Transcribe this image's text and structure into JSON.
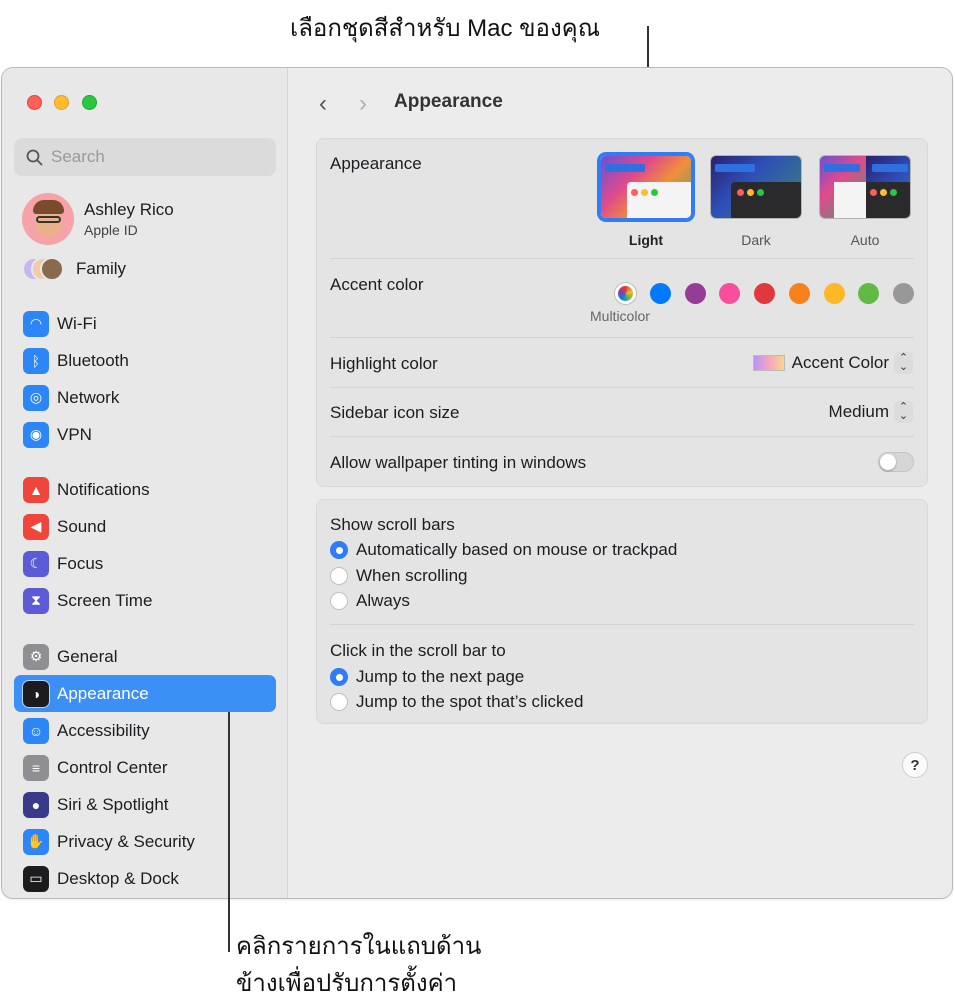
{
  "callouts": {
    "top": "เลือกชุดสีสำหรับ Mac ของคุณ",
    "bottom_line1": "คลิกรายการในแถบด้าน",
    "bottom_line2": "ข้างเพื่อปรับการตั้งค่า"
  },
  "sidebar": {
    "search_placeholder": "Search",
    "profile": {
      "name": "Ashley Rico",
      "subtitle": "Apple ID"
    },
    "family_label": "Family",
    "groups": [
      [
        {
          "label": "Wi-Fi",
          "icon": "wifi-icon",
          "color": "#2d86f5"
        },
        {
          "label": "Bluetooth",
          "icon": "bluetooth-icon",
          "color": "#2d86f5"
        },
        {
          "label": "Network",
          "icon": "globe-icon",
          "color": "#2d86f5"
        },
        {
          "label": "VPN",
          "icon": "vpn-globe-icon",
          "color": "#2d86f5"
        }
      ],
      [
        {
          "label": "Notifications",
          "icon": "bell-icon",
          "color": "#f0453a"
        },
        {
          "label": "Sound",
          "icon": "speaker-icon",
          "color": "#f0453a"
        },
        {
          "label": "Focus",
          "icon": "moon-icon",
          "color": "#5b5bd6"
        },
        {
          "label": "Screen Time",
          "icon": "hourglass-icon",
          "color": "#5b5bd6"
        }
      ],
      [
        {
          "label": "General",
          "icon": "gear-icon",
          "color": "#8e8e93"
        },
        {
          "label": "Appearance",
          "icon": "appearance-icon",
          "color": "#1c1c1e",
          "active": true
        },
        {
          "label": "Accessibility",
          "icon": "accessibility-icon",
          "color": "#2d86f5"
        },
        {
          "label": "Control Center",
          "icon": "toggles-icon",
          "color": "#8e8e93"
        },
        {
          "label": "Siri & Spotlight",
          "icon": "siri-icon",
          "color": "#3a3a8a"
        },
        {
          "label": "Privacy & Security",
          "icon": "hand-icon",
          "color": "#2d86f5"
        },
        {
          "label": "Desktop & Dock",
          "icon": "dock-icon",
          "color": "#1c1c1e"
        }
      ]
    ]
  },
  "main": {
    "title": "Appearance",
    "appearance": {
      "label": "Appearance",
      "options": [
        "Light",
        "Dark",
        "Auto"
      ],
      "selected": "Light"
    },
    "accent": {
      "label": "Accent color",
      "selected_label": "Multicolor",
      "colors": [
        "#007aff",
        "#953d96",
        "#f74f9e",
        "#e0383e",
        "#f7821b",
        "#fcb827",
        "#62ba46",
        "#989898"
      ]
    },
    "highlight": {
      "label": "Highlight color",
      "value": "Accent Color"
    },
    "sidebar_icon_size": {
      "label": "Sidebar icon size",
      "value": "Medium"
    },
    "wallpaper_tinting": {
      "label": "Allow wallpaper tinting in windows",
      "on": false
    },
    "scroll_bars": {
      "label": "Show scroll bars",
      "options": [
        "Automatically based on mouse or trackpad",
        "When scrolling",
        "Always"
      ],
      "selected": 0
    },
    "click_scroll": {
      "label": "Click in the scroll bar to",
      "options": [
        "Jump to the next page",
        "Jump to the spot that’s clicked"
      ],
      "selected": 0
    },
    "help": "?"
  }
}
